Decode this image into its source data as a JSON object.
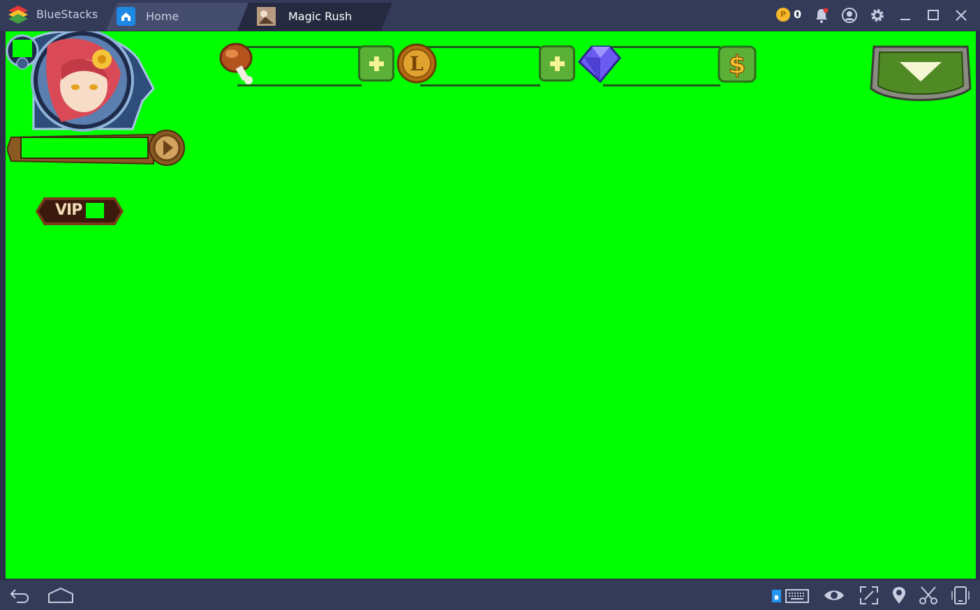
{
  "window": {
    "app_name": "BlueStacks",
    "tabs": [
      {
        "label": "Home",
        "icon": "home-icon"
      },
      {
        "label": "Magic Rush",
        "icon": "game-icon"
      }
    ],
    "coin_count": "0",
    "toolbar_icons": [
      "coin-icon",
      "notification-bell-icon",
      "account-icon",
      "gear-icon",
      "minimize-icon",
      "maximize-icon",
      "close-icon"
    ]
  },
  "game_hud": {
    "vip_label": "VIP",
    "resources": [
      {
        "name": "food",
        "icon": "meat-drumstick-icon",
        "action": "plus"
      },
      {
        "name": "gold",
        "icon": "gold-coin-icon",
        "action": "plus"
      },
      {
        "name": "diamonds",
        "icon": "diamond-icon",
        "action": "dollar"
      }
    ]
  },
  "bottom_bar_icons": [
    "back-icon",
    "home-icon",
    "keyboard-icon",
    "eye-icon",
    "fullscreen-icon",
    "location-icon",
    "scissors-icon",
    "rotate-device-icon"
  ],
  "colors": {
    "chroma_background": "#00ff00",
    "titlebar": "#343b59",
    "active_tab": "#252a40",
    "accent_coin": "#f5b82a"
  }
}
